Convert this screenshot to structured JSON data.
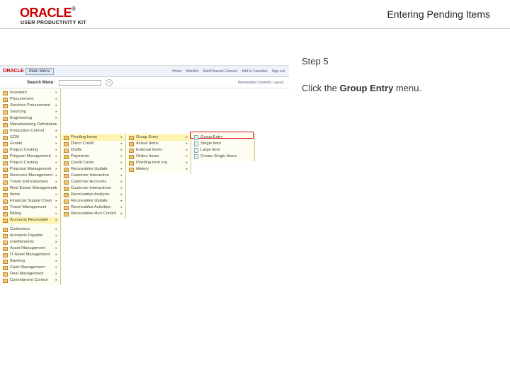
{
  "header": {
    "logo": "ORACLE",
    "tm": "®",
    "subtitle": "USER PRODUCTIVITY KIT",
    "title": "Entering Pending Items"
  },
  "step": "Step 5",
  "instruction_pre": "Click the ",
  "instruction_bold": "Group Entry",
  "instruction_post": " menu.",
  "nav": {
    "oracle": "ORACLE",
    "mainmenu": "Main Menu",
    "links": [
      "Home",
      "Worklist",
      "MultiChannel Console",
      "Add to Favorites",
      "Sign out"
    ]
  },
  "search": {
    "label": "Search Menu:",
    "go": "»",
    "pc": "Personalize Content | Layout"
  },
  "col1": [
    "Inventory",
    "Procurement",
    "Services Procurement",
    "Sourcing",
    "Engineering",
    "Manufacturing Definitions",
    "Production Control",
    "SCM",
    "Grants",
    "Project Costing",
    "Program Management",
    "Project Costing",
    "Proposal Management",
    "Resource Management",
    "Travel and Expenses",
    "Real Estate Management",
    "Items",
    "Financial Supply Chain",
    "Travel Management",
    "Billing",
    "Accounts Receivable"
  ],
  "col1b": [
    "Customers",
    "Accounts Payable",
    "eSettlements",
    "Asset Management",
    "IT Asset Management",
    "Banking",
    "Cash Management",
    "Deal Management",
    "Commitment Control"
  ],
  "col2": [
    "Pending Items",
    "Direct Credit",
    "Drafts",
    "Payments",
    "Credit Cards",
    "Receivables Update",
    "Customer Interaction",
    "Customer Accounts",
    "Customer Interactions",
    "Receivables Analysis",
    "Receivables Update",
    "Receivables Activities",
    "Receivables Run Control"
  ],
  "col3": [
    "Group Entry",
    "Actual Items",
    "External Items",
    "Online Items",
    "Pending Item Inq",
    "History"
  ],
  "col4": [
    "Group Entry",
    "Single Item",
    "Large Item",
    "Create Single Items"
  ]
}
